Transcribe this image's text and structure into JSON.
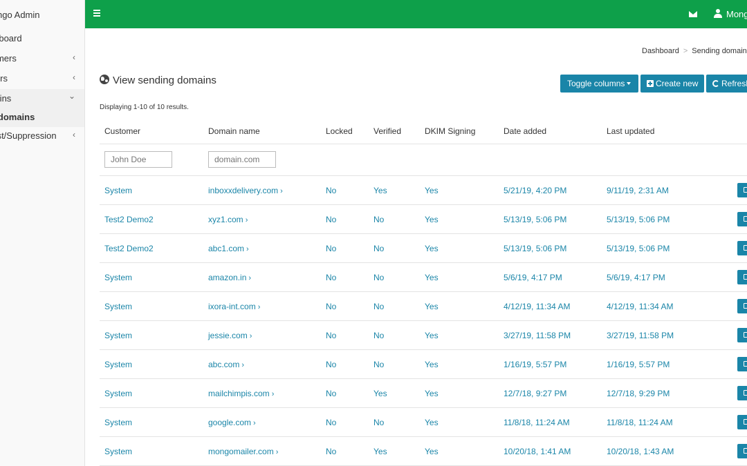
{
  "sidebar": {
    "brand": "Mongo Admin",
    "items": [
      {
        "label": "Dashboard",
        "chevron": ""
      },
      {
        "label": "Customers",
        "chevron": "‹"
      },
      {
        "label": "Users",
        "chevron": "‹"
      },
      {
        "label": "Domains",
        "chevron": "⌄"
      },
      {
        "label": "Sending domains",
        "chevron": ""
      },
      {
        "label": "Blacklist/Suppression",
        "chevron": "‹"
      }
    ]
  },
  "topbar": {
    "user_name": "Mongo",
    "accent_color": "#0ea04a"
  },
  "breadcrumb": {
    "items": [
      "Dashboard",
      "Sending domains"
    ],
    "separator": ">"
  },
  "page": {
    "title": "View sending domains",
    "summary": "Displaying 1-10 of 10 results."
  },
  "buttons": {
    "toggle_columns": "Toggle columns",
    "create_new": "Create new",
    "refresh": "Refresh"
  },
  "table": {
    "headers": {
      "customer": "Customer",
      "domain": "Domain name",
      "locked": "Locked",
      "verified": "Verified",
      "dkim": "DKIM Signing",
      "added": "Date added",
      "updated": "Last updated"
    },
    "filters": {
      "customer_placeholder": "John Doe",
      "domain_placeholder": "domain.com"
    },
    "rows": [
      {
        "customer": "System",
        "domain": "inboxxdelivery.com",
        "locked": "No",
        "verified": "Yes",
        "dkim": "Yes",
        "added": "5/21/19, 4:20 PM",
        "updated": "9/11/19, 2:31 AM"
      },
      {
        "customer": "Test2 Demo2",
        "domain": "xyz1.com",
        "locked": "No",
        "verified": "No",
        "dkim": "Yes",
        "added": "5/13/19, 5:06 PM",
        "updated": "5/13/19, 5:06 PM"
      },
      {
        "customer": "Test2 Demo2",
        "domain": "abc1.com",
        "locked": "No",
        "verified": "No",
        "dkim": "Yes",
        "added": "5/13/19, 5:06 PM",
        "updated": "5/13/19, 5:06 PM"
      },
      {
        "customer": "System",
        "domain": "amazon.in",
        "locked": "No",
        "verified": "No",
        "dkim": "Yes",
        "added": "5/6/19, 4:17 PM",
        "updated": "5/6/19, 4:17 PM"
      },
      {
        "customer": "System",
        "domain": "ixora-int.com",
        "locked": "No",
        "verified": "No",
        "dkim": "Yes",
        "added": "4/12/19, 11:34 AM",
        "updated": "4/12/19, 11:34 AM"
      },
      {
        "customer": "System",
        "domain": "jessie.com",
        "locked": "No",
        "verified": "No",
        "dkim": "Yes",
        "added": "3/27/19, 11:58 PM",
        "updated": "3/27/19, 11:58 PM"
      },
      {
        "customer": "System",
        "domain": "abc.com",
        "locked": "No",
        "verified": "No",
        "dkim": "Yes",
        "added": "1/16/19, 5:57 PM",
        "updated": "1/16/19, 5:57 PM"
      },
      {
        "customer": "System",
        "domain": "mailchimpis.com",
        "locked": "No",
        "verified": "Yes",
        "dkim": "Yes",
        "added": "12/7/18, 9:27 PM",
        "updated": "12/7/18, 9:29 PM"
      },
      {
        "customer": "System",
        "domain": "google.com",
        "locked": "No",
        "verified": "No",
        "dkim": "Yes",
        "added": "11/8/18, 11:24 AM",
        "updated": "11/8/18, 11:24 AM"
      },
      {
        "customer": "System",
        "domain": "mongomailer.com",
        "locked": "No",
        "verified": "Yes",
        "dkim": "Yes",
        "added": "10/20/18, 1:41 AM",
        "updated": "10/20/18, 1:43 AM"
      }
    ]
  }
}
